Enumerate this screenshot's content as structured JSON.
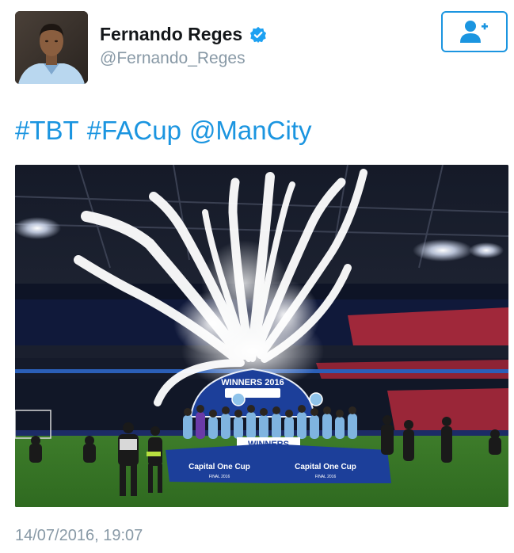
{
  "tweet": {
    "author": {
      "display_name": "Fernando Reges",
      "handle": "@Fernando_Reges",
      "verified": true,
      "avatar_icon": "profile-photo"
    },
    "follow_button_icon": "add-user-icon",
    "text_parts": [
      "#TBT",
      "#FACup",
      "@ManCity"
    ],
    "media": {
      "banner_title": "WINNERS 2016",
      "board_text_left": "Capital One Cup",
      "board_text_right": "Capital One Cup",
      "board_subtext": "FINAL 2016",
      "players_banner": "WINNERS"
    },
    "timestamp": "14/07/2016, 19:07"
  },
  "colors": {
    "link": "#1b95e0",
    "text": "#14171a",
    "muted": "#8899a6",
    "banner_blue": "#1c3f9a",
    "pitch_green": "#3f7f2a"
  }
}
